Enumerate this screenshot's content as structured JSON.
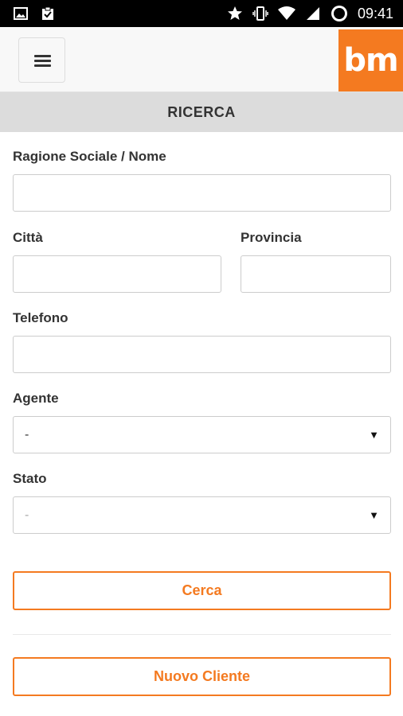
{
  "status_bar": {
    "time": "09:41",
    "icons_left": [
      "image-icon",
      "clipboard-check-icon"
    ],
    "icons_right": [
      "star-icon",
      "vibrate-icon",
      "wifi-icon",
      "signal-icon",
      "battery-icon"
    ]
  },
  "header": {
    "logo_text": "bm",
    "brand_color": "#f47a20"
  },
  "title": "RICERCA",
  "form": {
    "ragione_label": "Ragione Sociale / Nome",
    "ragione_value": "",
    "citta_label": "Città",
    "citta_value": "",
    "provincia_label": "Provincia",
    "provincia_value": "",
    "telefono_label": "Telefono",
    "telefono_value": "",
    "agente_label": "Agente",
    "agente_selected": "-",
    "stato_label": "Stato",
    "stato_selected": "-"
  },
  "buttons": {
    "search_label": "Cerca",
    "new_client_label": "Nuovo Cliente"
  }
}
